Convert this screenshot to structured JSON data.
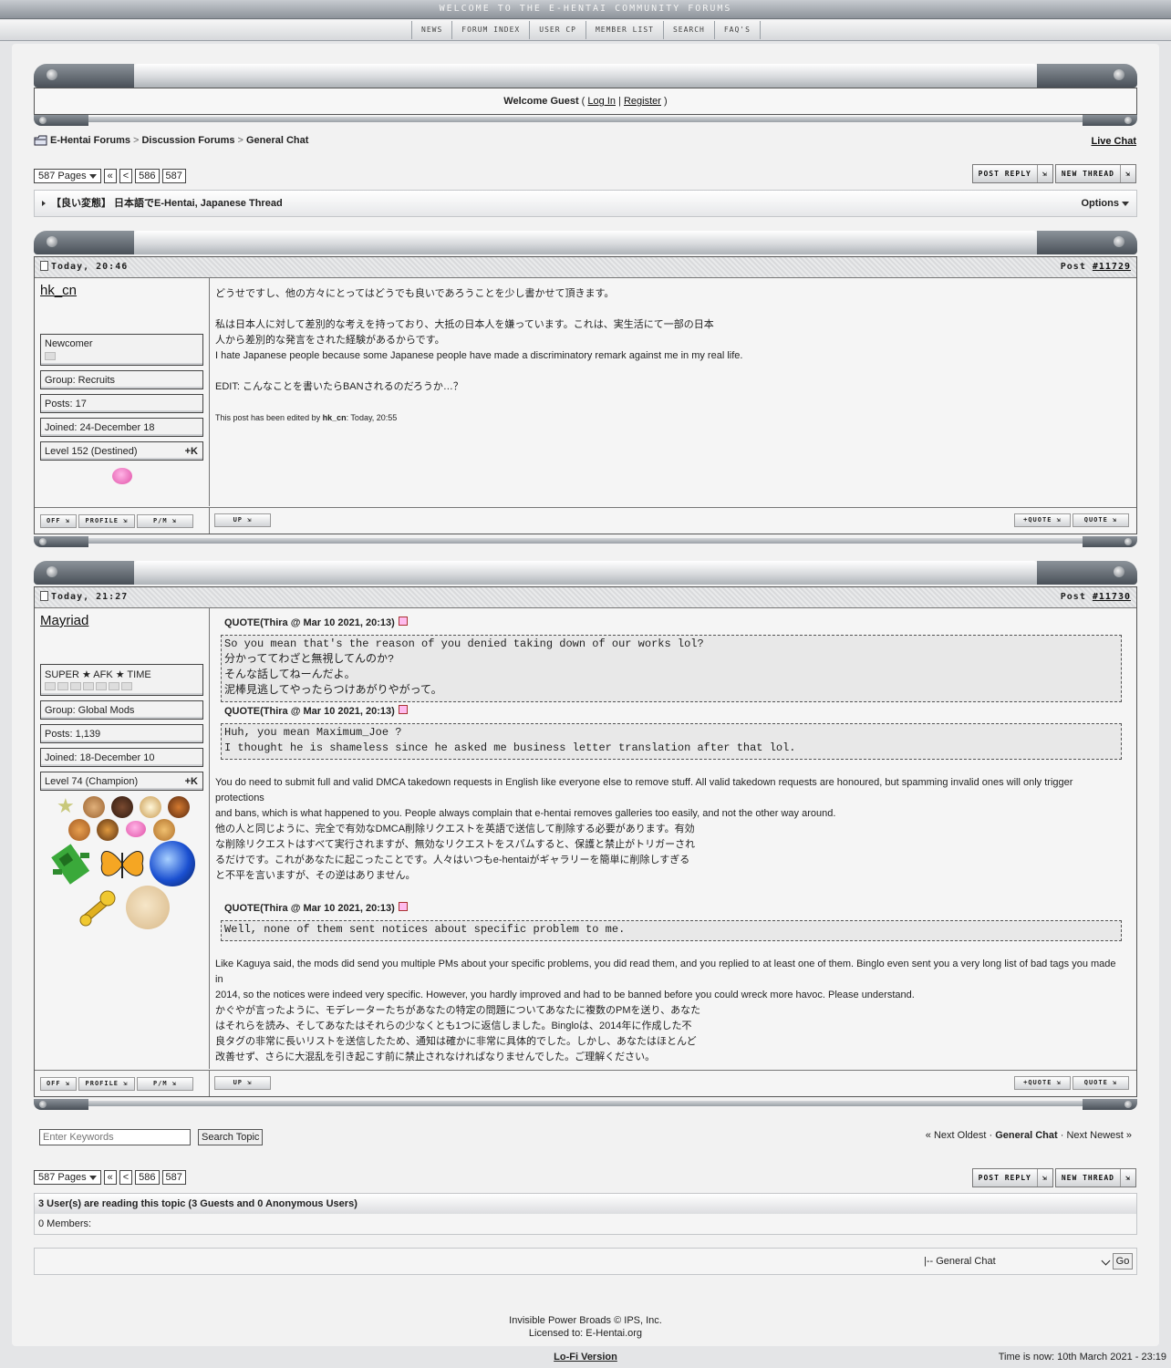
{
  "banner": "WELCOME TO THE E-HENTAI COMMUNITY FORUMS",
  "nav": [
    "NEWS",
    "FORUM INDEX",
    "USER CP",
    "MEMBER LIST",
    "SEARCH",
    "FAQ'S"
  ],
  "welcome": {
    "text": "Welcome Guest",
    "open": " ( ",
    "login": "Log In",
    "bar": " | ",
    "register": "Register",
    "close": " )"
  },
  "breadcrumb": [
    "E-Hentai Forums",
    "Discussion Forums",
    "General Chat"
  ],
  "breadcrumb_sep": ">",
  "live_chat": "Live Chat",
  "pagination": {
    "pages": "587 Pages",
    "first": "«",
    "prev": "<",
    "p1": "586",
    "p2": "587"
  },
  "buttons": {
    "post_reply": "POST REPLY",
    "new_thread": "NEW THREAD"
  },
  "topic_title": "【良い変態】 日本語でE-Hentai, Japanese Thread",
  "options": "Options",
  "post_btns": {
    "off": "OFF",
    "profile": "PROFILE",
    "pm": "P/M",
    "up": "UP",
    "plus_quote": "+QUOTE",
    "quote": "QUOTE"
  },
  "posts": [
    {
      "date": "Today, 20:46",
      "post_label": "Post ",
      "post_no": "#11729",
      "user": "hk_cn",
      "title": "Newcomer",
      "group": "Group: Recruits",
      "posts": "Posts: 17",
      "joined": "Joined: 24-December 18",
      "level": "Level 152 (Destined)",
      "karma": "+K",
      "body": [
        "どうせですし、他の方々にとってはどうでも良いであろうことを少し書かせて頂きます。",
        "私は日本人に対して差別的な考えを持っており、大抵の日本人を嫌っています。これは、実生活にて一部の日本",
        "人から差別的な発言をされた経験があるからです。",
        "I hate Japanese people because some Japanese people have made a discriminatory remark against me in my real life.",
        "EDIT: こんなことを書いたらBANされるのだろうか…？"
      ],
      "edited_pre": "This post has been edited by ",
      "edited_by": "hk_cn",
      "edited_post": ": Today, 20:55"
    },
    {
      "date": "Today, 21:27",
      "post_label": "Post ",
      "post_no": "#11730",
      "user": "Mayriad",
      "title": "SUPER ★ AFK ★ TIME",
      "group": "Group: Global Mods",
      "posts": "Posts: 1,139",
      "joined": "Joined: 18-December 10",
      "level": "Level 74 (Champion)",
      "karma": "+K",
      "quote_head": "QUOTE(Thira @ Mar 10 2021, 20:13)",
      "quote1": [
        "So you mean that's the reason of you denied taking down of our works lol?",
        "分かっててわざと無視してんのか?",
        "そんな話してねーんだよ。",
        "泥棒見逃してやったらつけあがりやがって。"
      ],
      "quote2": [
        "Huh, you mean Maximum_Joe ?",
        "I thought he is shameless since he asked me business letter translation after that lol."
      ],
      "para1": [
        "You do need to submit full and valid DMCA takedown requests in English like everyone else to remove stuff. All valid takedown requests are honoured, but spamming invalid ones will only trigger protections",
        "and bans, which is what happened to you. People always complain that e-hentai removes galleries too easily, and not the other way around."
      ],
      "para2": [
        "他の人と同じように、完全で有効なDMCA削除リクエストを英語で送信して削除する必要があります。有効",
        "な削除リクエストはすべて実行されますが、無効なリクエストをスパムすると、保護と禁止がトリガーされ",
        "るだけです。これがあなたに起こったことです。人々はいつもe-hentaiがギャラリーを簡単に削除しすぎる",
        "と不平を言いますが、その逆はありません。"
      ],
      "quote3": [
        "Well, none of them sent notices about specific problem to me."
      ],
      "para3": [
        "Like Kaguya said, the mods did send you multiple PMs about your specific problems, you did read them, and you replied to at least one of them. Binglo even sent you a very long list of bad tags you made in",
        "2014, so the notices were indeed very specific. However, you hardly improved and had to be banned before you could wreck more havoc. Please understand."
      ],
      "para4": [
        "かぐやが言ったように、モデレーターたちがあなたの特定の問題についてあなたに複数のPMを送り、あなた",
        "はそれらを読み、そしてあなたはそれらの少なくとも1つに返信しました。Bingloは、2014年に作成した不",
        "良タグの非常に長いリストを送信したため、通知は確かに非常に具体的でした。しかし、あなたはほとんど",
        "改善せず、さらに大混乱を引き起こす前に禁止されなければなりませんでした。ご理解ください。"
      ]
    }
  ],
  "search": {
    "placeholder": "Enter Keywords",
    "button": "Search Topic"
  },
  "topic_nav": {
    "prev": "« Next Oldest",
    "dot1": " · ",
    "current": "General Chat",
    "dot2": " · ",
    "next": "Next Newest »"
  },
  "readers": {
    "header": "3 User(s) are reading this topic (3 Guests and 0 Anonymous Users)",
    "members": "0 Members:"
  },
  "jump": {
    "selected": "|-- General Chat",
    "go": "Go"
  },
  "footer": {
    "line1a": "Invisible Power Broads",
    "line1b": " © IPS, Inc.",
    "line2": "Licensed to: E-Hentai.org"
  },
  "lofi": "Lo-Fi Version",
  "time": "Time is now: 10th March 2021 - 23:19",
  "colors": {
    "accent": "#495058",
    "quote_bg": "#e8e8e8",
    "background": "#e4e5e7"
  }
}
